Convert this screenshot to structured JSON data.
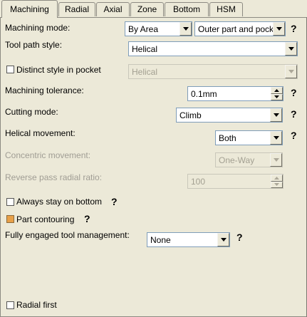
{
  "tabs": [
    "Machining",
    "Radial",
    "Axial",
    "Zone",
    "Bottom",
    "HSM"
  ],
  "help_mark": "?",
  "machining_mode": {
    "label": "Machining mode:",
    "value1": "By Area",
    "value2": "Outer part and pock"
  },
  "tool_path_style": {
    "label": "Tool path style:",
    "value": "Helical"
  },
  "distinct_style": {
    "label": "Distinct style in pocket",
    "value": "Helical",
    "checked": false
  },
  "machining_tolerance": {
    "label": "Machining tolerance:",
    "value": "0.1mm"
  },
  "cutting_mode": {
    "label": "Cutting mode:",
    "value": "Climb"
  },
  "helical_movement": {
    "label": "Helical movement:",
    "value": "Both"
  },
  "concentric_movement": {
    "label": "Concentric movement:",
    "value": "One-Way"
  },
  "reverse_pass": {
    "label": "Reverse pass radial ratio:",
    "value": "100"
  },
  "always_stay_on_bottom": {
    "label": "Always stay on bottom",
    "checked": false
  },
  "part_contouring": {
    "label": "Part contouring",
    "checked": true
  },
  "fully_engaged": {
    "label": "Fully engaged tool management:",
    "value": "None"
  },
  "radial_first": {
    "label": "Radial first",
    "checked": false
  }
}
